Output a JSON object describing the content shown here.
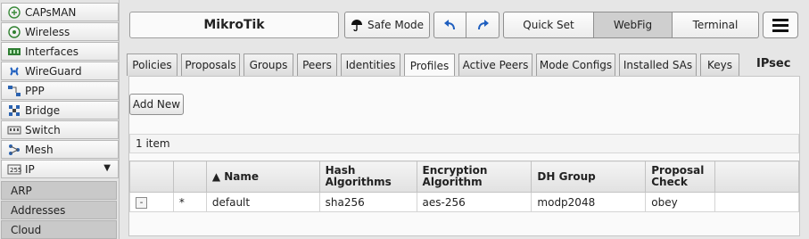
{
  "sidebar": {
    "items": [
      {
        "label": "CAPsMAN",
        "icon": "capsman-icon"
      },
      {
        "label": "Wireless",
        "icon": "wireless-icon"
      },
      {
        "label": "Interfaces",
        "icon": "interfaces-icon"
      },
      {
        "label": "WireGuard",
        "icon": "wireguard-icon"
      },
      {
        "label": "PPP",
        "icon": "ppp-icon"
      },
      {
        "label": "Bridge",
        "icon": "bridge-icon"
      },
      {
        "label": "Switch",
        "icon": "switch-icon"
      },
      {
        "label": "Mesh",
        "icon": "mesh-icon"
      },
      {
        "label": "IP",
        "icon": "ip-icon",
        "expanded": true
      }
    ],
    "subitems": [
      {
        "label": "ARP"
      },
      {
        "label": "Addresses"
      },
      {
        "label": "Cloud"
      }
    ]
  },
  "header": {
    "brand": "MikroTik",
    "safe_mode": "Safe Mode",
    "modes": [
      {
        "label": "Quick Set",
        "active": false
      },
      {
        "label": "WebFig",
        "active": true
      },
      {
        "label": "Terminal",
        "active": false
      }
    ]
  },
  "tabs": [
    {
      "label": "Policies"
    },
    {
      "label": "Proposals"
    },
    {
      "label": "Groups"
    },
    {
      "label": "Peers"
    },
    {
      "label": "Identities"
    },
    {
      "label": "Profiles",
      "active": true
    },
    {
      "label": "Active Peers"
    },
    {
      "label": "Mode Configs"
    },
    {
      "label": "Installed SAs"
    },
    {
      "label": "Keys"
    }
  ],
  "section_title": "IPsec",
  "toolbar": {
    "add_new": "Add New"
  },
  "list": {
    "count_text": "1 item",
    "columns": {
      "name": "▲ Name",
      "hash_1": "Hash",
      "hash_2": "Algorithms",
      "enc_1": "Encryption",
      "enc_2": "Algorithm",
      "dh": "DH Group",
      "prop_1": "Proposal",
      "prop_2": "Check"
    },
    "rows": [
      {
        "remove": "-",
        "flag": "*",
        "name": "default",
        "hash": "sha256",
        "enc": "aes-256",
        "dh": "modp2048",
        "proposal": "obey"
      }
    ]
  },
  "colors": {
    "background": "#e6e6e6",
    "panel": "#fafafa",
    "active_tab": "#fafafa",
    "active_mode": "#cfcfcf"
  }
}
